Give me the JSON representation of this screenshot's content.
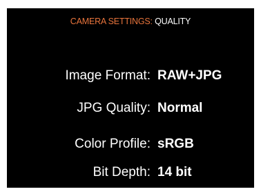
{
  "header": {
    "category": "CAMERA SETTINGS:",
    "section": "QUALITY",
    "category_color": "#e8743c",
    "section_color": "#ffffff"
  },
  "settings": [
    {
      "label": "Image Format:",
      "value": "RAW+JPG"
    },
    {
      "label": "JPG Quality:",
      "value": "Normal"
    },
    {
      "label": "Color Profile:",
      "value": "sRGB"
    },
    {
      "label": "Bit Depth:",
      "value": "14 bit"
    }
  ],
  "colors": {
    "background": "#000000",
    "text": "#ffffff",
    "accent": "#e8743c"
  }
}
